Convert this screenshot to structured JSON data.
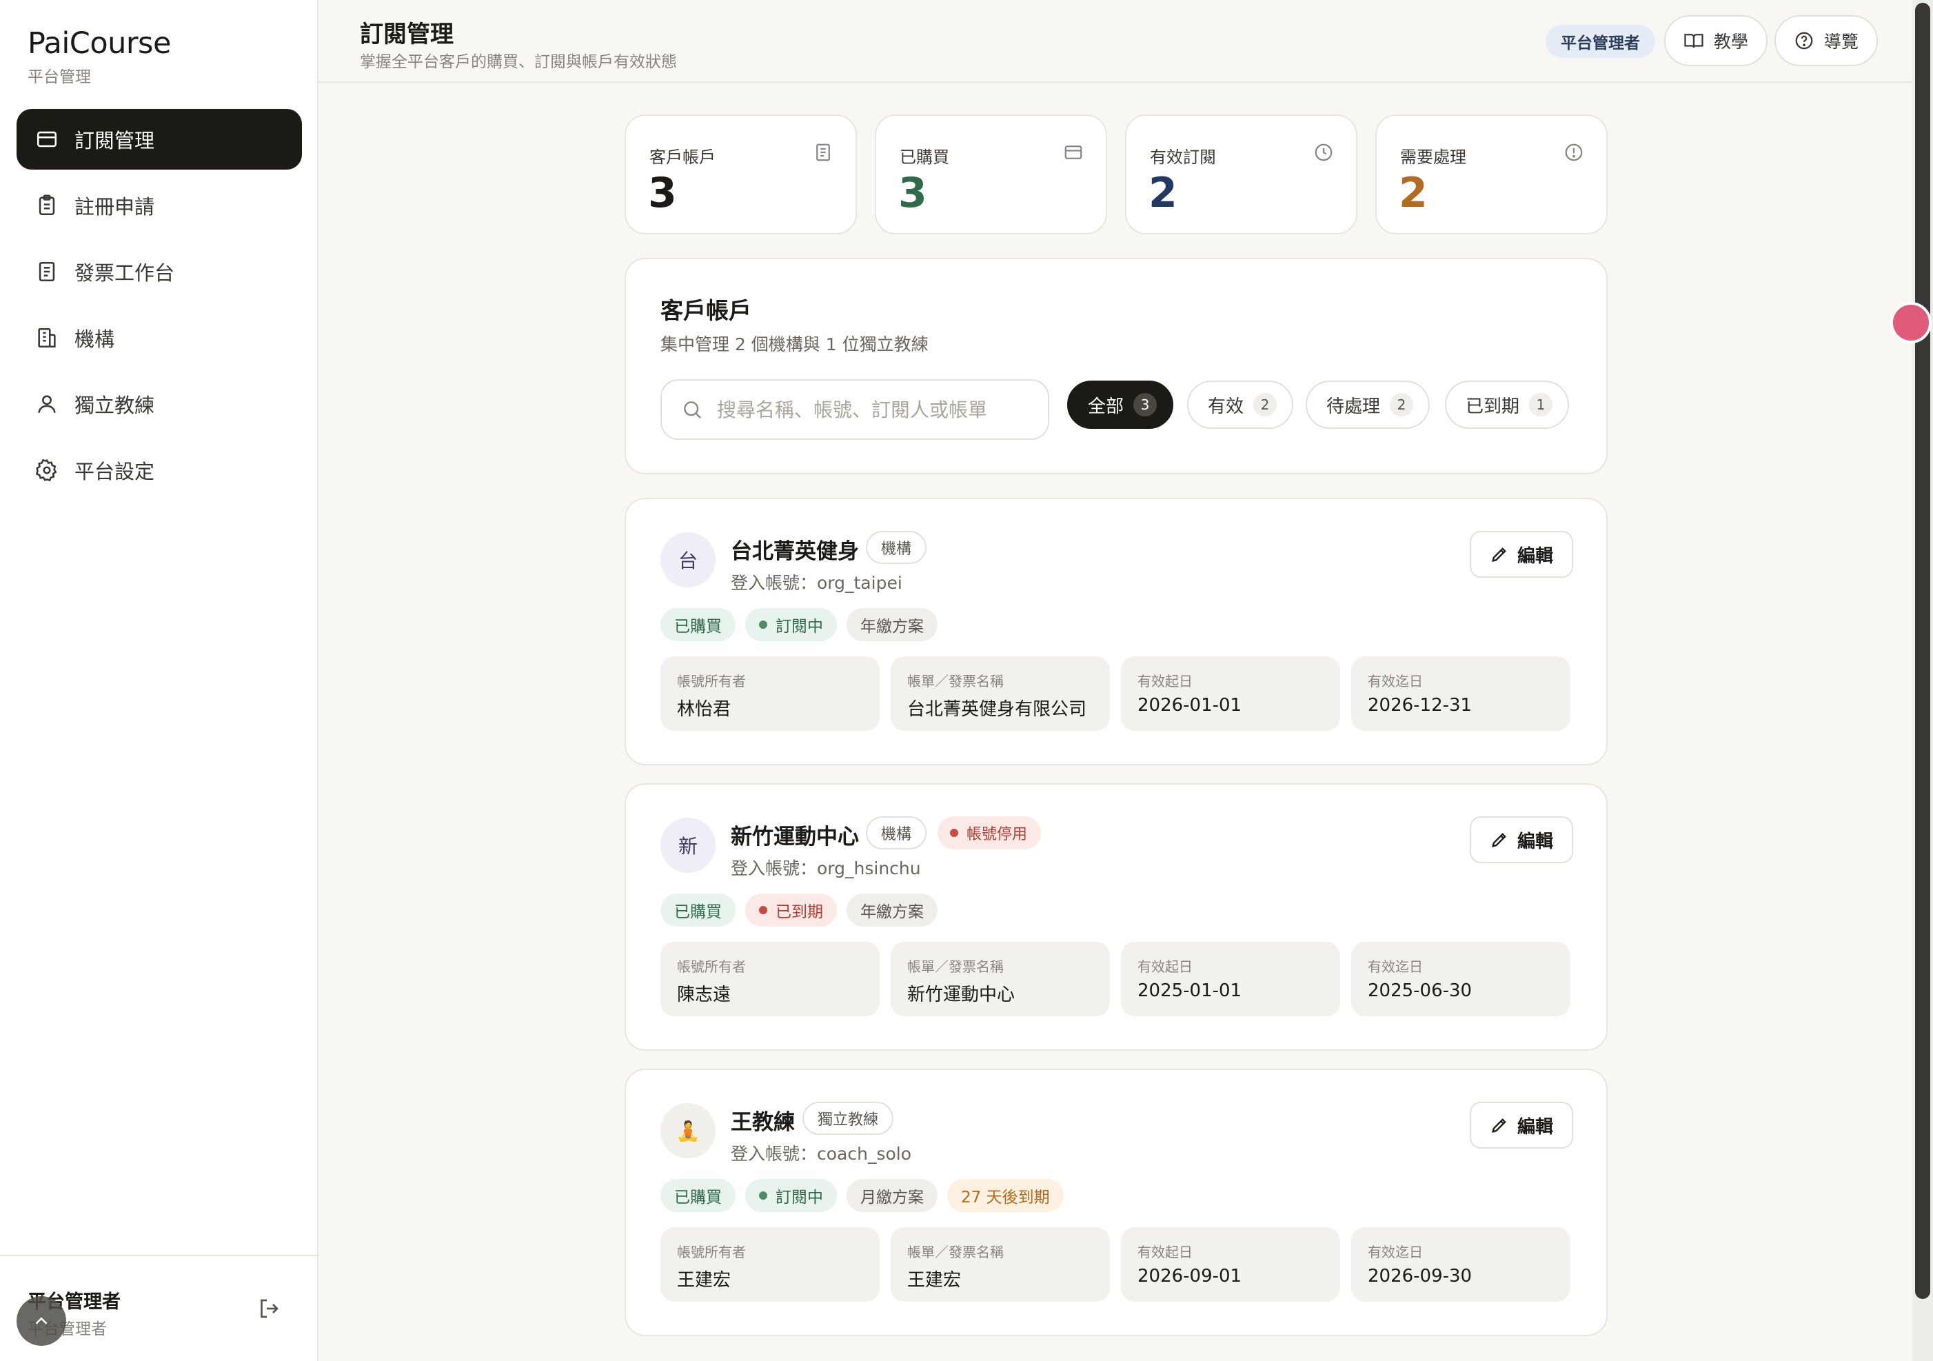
{
  "brand": {
    "name": "PaiCourse",
    "subtitle": "平台管理"
  },
  "nav": [
    {
      "label": "訂閱管理",
      "icon": "credit-card-icon",
      "active": true
    },
    {
      "label": "註冊申請",
      "icon": "clipboard-icon",
      "active": false
    },
    {
      "label": "發票工作台",
      "icon": "receipt-icon",
      "active": false
    },
    {
      "label": "機構",
      "icon": "building-icon",
      "active": false
    },
    {
      "label": "獨立教練",
      "icon": "user-icon",
      "active": false
    },
    {
      "label": "平台設定",
      "icon": "gear-icon",
      "active": false
    }
  ],
  "sidebar_footer": {
    "name": "平台管理者",
    "role": "平台管理者"
  },
  "header": {
    "title": "訂閱管理",
    "subtitle": "掌握全平台客戶的購買、訂閱與帳戶有效狀態",
    "role_chip": "平台管理者",
    "tutorial_label": "教學",
    "guide_label": "導覽"
  },
  "stats": [
    {
      "label": "客戶帳戶",
      "value": "3",
      "color": "#1c1a17",
      "icon": "document-icon"
    },
    {
      "label": "已購買",
      "value": "3",
      "color": "#2f6b4a",
      "icon": "credit-card-icon"
    },
    {
      "label": "有效訂閱",
      "value": "2",
      "color": "#223a63",
      "icon": "clock-icon"
    },
    {
      "label": "需要處理",
      "value": "2",
      "color": "#b36b1e",
      "icon": "alert-circle-icon"
    }
  ],
  "filter_panel": {
    "title": "客戶帳戶",
    "subtitle": "集中管理 2 個機構與 1 位獨立教練",
    "search_placeholder": "搜尋名稱、帳號、訂閱人或帳單",
    "filters": [
      {
        "label": "全部",
        "count": "3",
        "active": true
      },
      {
        "label": "有效",
        "count": "2",
        "active": false
      },
      {
        "label": "待處理",
        "count": "2",
        "active": false
      },
      {
        "label": "已到期",
        "count": "1",
        "active": false
      }
    ]
  },
  "accounts": [
    {
      "avatar": "台",
      "name": "台北菁英健身",
      "type": "機構",
      "disabled_label": "",
      "login": "登入帳號：org_taipei",
      "edit_label": "編輯",
      "tags": [
        {
          "label": "已購買",
          "kind": "bought",
          "dot": false
        },
        {
          "label": "訂閱中",
          "kind": "active",
          "dot": true
        },
        {
          "label": "年繳方案",
          "kind": "plan",
          "dot": false
        }
      ],
      "fields": [
        {
          "label": "帳號所有者",
          "value": "林怡君"
        },
        {
          "label": "帳單／發票名稱",
          "value": "台北菁英健身有限公司"
        },
        {
          "label": "有效起日",
          "value": "2026-01-01"
        },
        {
          "label": "有效迄日",
          "value": "2026-12-31"
        }
      ]
    },
    {
      "avatar": "新",
      "name": "新竹運動中心",
      "type": "機構",
      "disabled_label": "帳號停用",
      "login": "登入帳號：org_hsinchu",
      "edit_label": "編輯",
      "tags": [
        {
          "label": "已購買",
          "kind": "bought",
          "dot": false
        },
        {
          "label": "已到期",
          "kind": "expired",
          "dot": true
        },
        {
          "label": "年繳方案",
          "kind": "plan",
          "dot": false
        }
      ],
      "fields": [
        {
          "label": "帳號所有者",
          "value": "陳志遠"
        },
        {
          "label": "帳單／發票名稱",
          "value": "新竹運動中心"
        },
        {
          "label": "有效起日",
          "value": "2025-01-01"
        },
        {
          "label": "有效迄日",
          "value": "2025-06-30"
        }
      ]
    },
    {
      "avatar": "🧘",
      "name": "王教練",
      "type": "獨立教練",
      "disabled_label": "",
      "login": "登入帳號：coach_solo",
      "edit_label": "編輯",
      "tags": [
        {
          "label": "已購買",
          "kind": "bought",
          "dot": false
        },
        {
          "label": "訂閱中",
          "kind": "active",
          "dot": true
        },
        {
          "label": "月繳方案",
          "kind": "plan",
          "dot": false
        },
        {
          "label": "27 天後到期",
          "kind": "warn",
          "dot": false
        }
      ],
      "fields": [
        {
          "label": "帳號所有者",
          "value": "王建宏"
        },
        {
          "label": "帳單／發票名稱",
          "value": "王建宏"
        },
        {
          "label": "有效起日",
          "value": "2026-09-01"
        },
        {
          "label": "有效迄日",
          "value": "2026-09-30"
        }
      ]
    }
  ]
}
